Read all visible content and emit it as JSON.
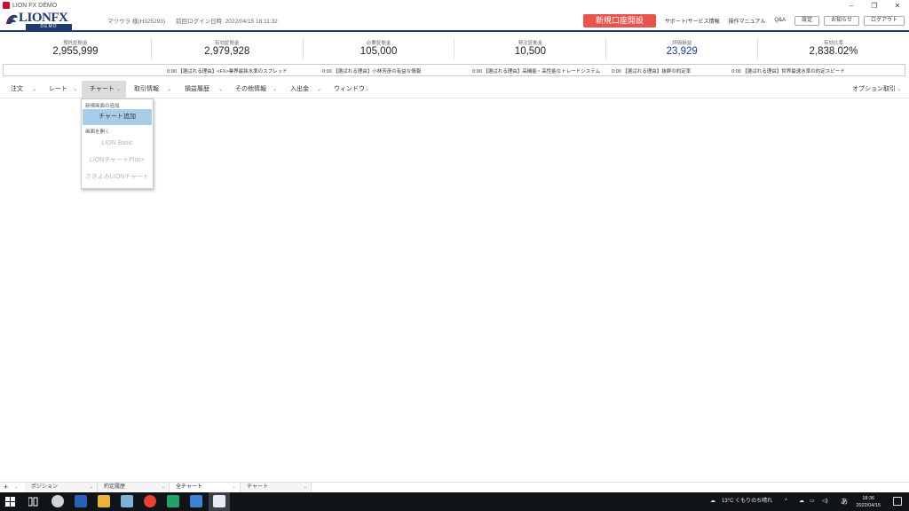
{
  "window": {
    "title": "LION FX DEMO",
    "minimize": "–",
    "restore": "❐",
    "close": "✕"
  },
  "header": {
    "logo_text": "LIONFX",
    "logo_sub": "DEMO",
    "user": "マツウラ 様(H325293)",
    "last_login": "前回ログイン日時: 2022/04/15 18:11:32",
    "open_account": "新規口座開設",
    "links": [
      "サポート/サービス情報",
      "操作マニュアル",
      "Q&A"
    ],
    "buttons": [
      "設定",
      "お知らせ",
      "ログアウト"
    ]
  },
  "summary": [
    {
      "label": "預託証拠金",
      "value": "2,955,999",
      "blue": false
    },
    {
      "label": "有効証拠金",
      "value": "2,979,928",
      "blue": false
    },
    {
      "label": "必要証拠金",
      "value": "105,000",
      "blue": false
    },
    {
      "label": "発注証拠金",
      "value": "10,500",
      "blue": false
    },
    {
      "label": "評価損益",
      "value": "23,929",
      "blue": true
    },
    {
      "label": "有効比率",
      "value": "2,838.02%",
      "blue": false
    }
  ],
  "ticker": [
    "0:00 【選ばれる理由】<FX>業界最狭水準のスプレッド",
    "0:00 【選ばれる理由】小林芳彦の有益な情報",
    "0:00 【選ばれる理由】高機能・高性能なトレードシステム",
    "0:00 【選ばれる理由】抜群の約定率",
    "0:00 【選ばれる理由】世界最速水準の約定スピード"
  ],
  "menu": {
    "items": [
      "注文",
      "レート",
      "チャート",
      "取引情報",
      "損益履歴",
      "その他情報",
      "入出金",
      "ウィンドウ"
    ],
    "active_index": 2,
    "right": "オプション取引"
  },
  "dropdown": {
    "section_new": "新規画面の追加",
    "add_chart": "チャート追加",
    "section_open": "画面を開く",
    "items": [
      "LION Basic",
      "LIONチャートPlus+",
      "さきよみLIONチャート"
    ]
  },
  "tabs": {
    "plus": "+",
    "items": [
      "ポジション",
      "約定履歴",
      "全チャート",
      "チャート"
    ],
    "active_index": 2
  },
  "taskbar": {
    "weather": "13°C くもりのち晴れ",
    "ime": "あ",
    "time": "18:36",
    "date": "2022/04/15"
  },
  "colors": {
    "brand": "#1f3a6e",
    "accent": "#e8534b",
    "profit": "#1c3e9a",
    "selected": "#a9cde9"
  }
}
